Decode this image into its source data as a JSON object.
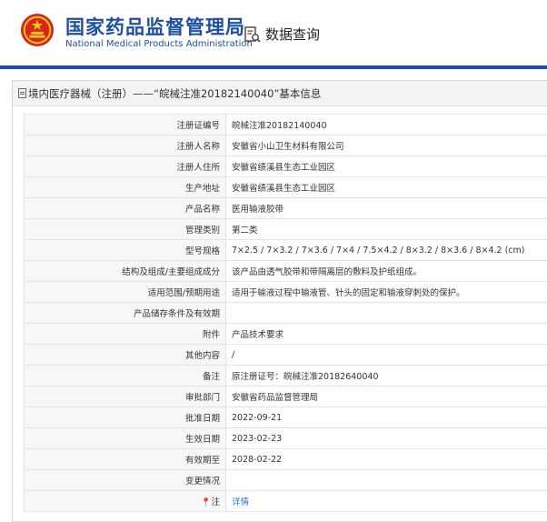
{
  "header": {
    "org_name_cn": "国家药品监督管理局",
    "org_name_en": "National Medical Products Administration",
    "nav_query": "数据查询"
  },
  "section": {
    "title": "境内医疗器械（注册）——“皖械注准20182140040”基本信息"
  },
  "rows": [
    {
      "label": "注册证编号",
      "value": "皖械注准20182140040"
    },
    {
      "label": "注册人名称",
      "value": "安徽省小山卫生材料有限公司"
    },
    {
      "label": "注册人住所",
      "value": "安徽省绩溪县生态工业园区"
    },
    {
      "label": "生产地址",
      "value": "安徽省绩溪县生态工业园区"
    },
    {
      "label": "产品名称",
      "value": "医用输液胶带"
    },
    {
      "label": "管理类别",
      "value": "第二类"
    },
    {
      "label": "型号规格",
      "value": "7×2.5 / 7×3.2 / 7×3.6 / 7×4 / 7.5×4.2 / 8×3.2 / 8×3.6 / 8×4.2 (cm)"
    },
    {
      "label": "结构及组成/主要组成成分",
      "value": "该产品由透气胶带和带隔离层的敷料及护纸组成。"
    },
    {
      "label": "适用范围/预期用途",
      "value": "适用于输液过程中输液管、针头的固定和输液穿刺处的保护。"
    },
    {
      "label": "产品储存条件及有效期",
      "value": ""
    },
    {
      "label": "附件",
      "value": "产品技术要求"
    },
    {
      "label": "其他内容",
      "value": "/"
    },
    {
      "label": "备注",
      "value": "原注册证号：皖械注准20182640040"
    },
    {
      "label": "审批部门",
      "value": "安徽省药品监督管理局"
    },
    {
      "label": "批准日期",
      "value": "2022-09-21"
    },
    {
      "label": "生效日期",
      "value": "2023-02-23"
    },
    {
      "label": "有效期至",
      "value": "2028-02-22"
    },
    {
      "label": "变更情况",
      "value": ""
    },
    {
      "label": "注",
      "value": "详情"
    }
  ],
  "colors": {
    "brand_blue": "#1f4fa0",
    "emblem_red": "#d7261d",
    "emblem_gold": "#f5c518",
    "link": "#2a6fd6"
  }
}
